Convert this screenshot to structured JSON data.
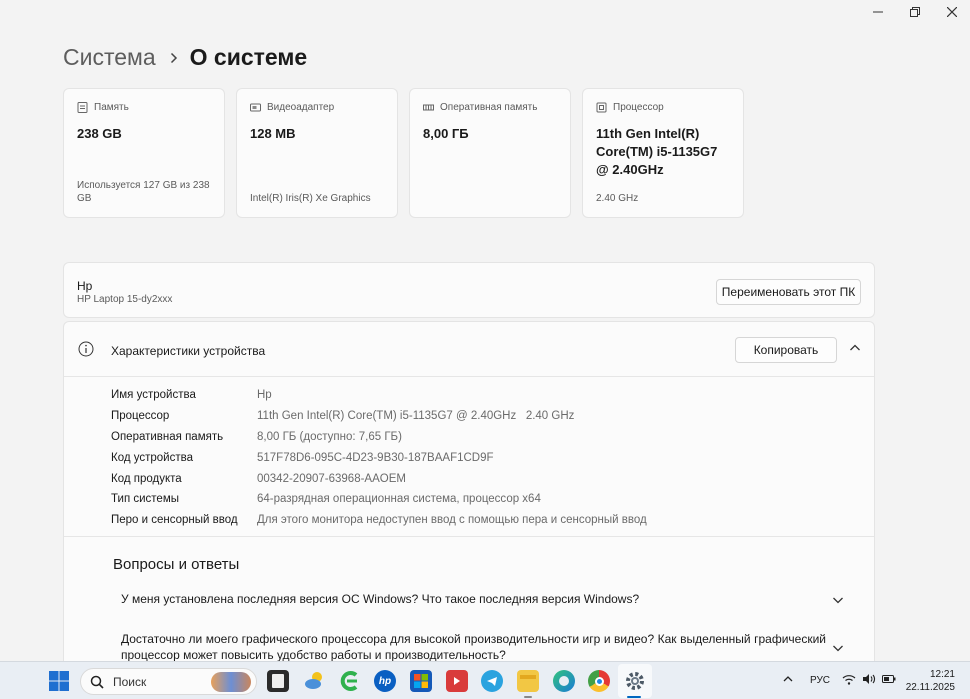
{
  "breadcrumb": {
    "parent": "Система",
    "current": "О системе"
  },
  "cards": [
    {
      "icon": "storage-icon",
      "label": "Память",
      "value": "238 GB",
      "sub": "Используется 127 GB из 238 GB"
    },
    {
      "icon": "display-adapter-icon",
      "label": "Видеоадаптер",
      "value": "128 MB",
      "sub": "Intel(R) Iris(R) Xe Graphics"
    },
    {
      "icon": "ram-icon",
      "label": "Оперативная память",
      "value": "8,00 ГБ",
      "sub": ""
    },
    {
      "icon": "processor-icon",
      "label": "Процессор",
      "value": "11th Gen Intel(R) Core(TM) i5-1135G7 @ 2.40GHz",
      "sub": "2.40 GHz"
    }
  ],
  "pc": {
    "name": "Hp",
    "model": "HP Laptop 15-dy2xxx",
    "rename_label": "Переименовать этот ПК"
  },
  "specs": {
    "title": "Характеристики устройства",
    "copy_label": "Копировать",
    "rows": [
      {
        "key": "Имя устройства",
        "value": "Hp"
      },
      {
        "key": "Процессор",
        "value": "11th Gen Intel(R) Core(TM) i5-1135G7 @ 2.40GHz   2.40 GHz"
      },
      {
        "key": "Оперативная память",
        "value": "8,00 ГБ (доступно: 7,65 ГБ)"
      },
      {
        "key": "Код устройства",
        "value": "517F78D6-095C-4D23-9B30-187BAAF1CD9F"
      },
      {
        "key": "Код продукта",
        "value": "00342-20907-63968-AAOEM"
      },
      {
        "key": "Тип системы",
        "value": "64-разрядная операционная система, процессор x64"
      },
      {
        "key": "Перо и сенсорный ввод",
        "value": "Для этого монитора недоступен ввод с помощью пера и сенсорный ввод"
      }
    ]
  },
  "faq": {
    "title": "Вопросы и ответы",
    "items": [
      "У меня установлена последняя версия ОС Windows? Что такое последняя версия Windows?",
      "Достаточно ли моего графического процессора для высокой производительности игр и видео? Как выделенный графический процессор может повысить удобство работы и производительность?"
    ]
  },
  "taskbar": {
    "search_placeholder": "Поиск",
    "language": "РУС",
    "time": "12:21",
    "date": "22.11.2025",
    "apps": [
      "file-explorer-dark-icon",
      "weather-icon",
      "green-app-icon",
      "hp-icon",
      "store-icon",
      "red-app-icon",
      "telegram-icon",
      "folder-icon",
      "edge-icon",
      "chrome-icon",
      "settings-icon"
    ]
  },
  "colors": {
    "accent": "#0067c0",
    "background": "#f3f3f3",
    "card": "#fbfbfb"
  }
}
